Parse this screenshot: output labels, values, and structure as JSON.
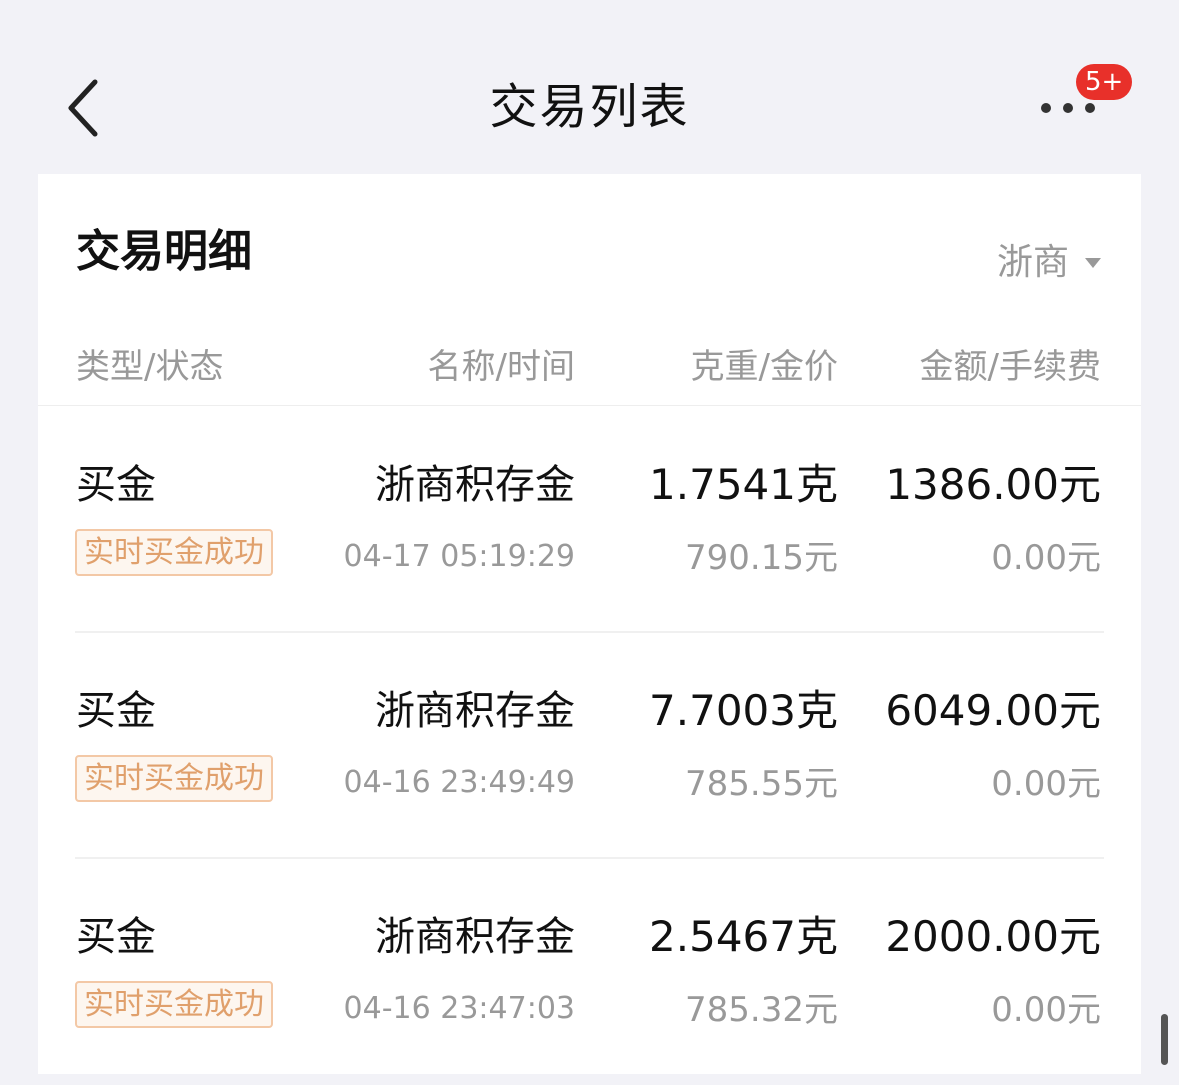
{
  "navbar": {
    "title": "交易列表",
    "badge": "5+"
  },
  "card": {
    "title": "交易明细",
    "filter_label": "浙商"
  },
  "columns": {
    "type_status": "类型/状态",
    "name_time": "名称/时间",
    "weight_price": "克重/金价",
    "amount_fee": "金额/手续费"
  },
  "transactions": [
    {
      "type": "买金",
      "status": "实时买金成功",
      "name": "浙商积存金",
      "time": "04-17 05:19:29",
      "weight": "1.7541克",
      "price": "790.15元",
      "amount": "1386.00元",
      "fee": "0.00元"
    },
    {
      "type": "买金",
      "status": "实时买金成功",
      "name": "浙商积存金",
      "time": "04-16 23:49:49",
      "weight": "7.7003克",
      "price": "785.55元",
      "amount": "6049.00元",
      "fee": "0.00元"
    },
    {
      "type": "买金",
      "status": "实时买金成功",
      "name": "浙商积存金",
      "time": "04-16 23:47:03",
      "weight": "2.5467克",
      "price": "785.32元",
      "amount": "2000.00元",
      "fee": "0.00元"
    }
  ],
  "colors": {
    "page_bg": "#f2f2f7",
    "badge": "#e8302a",
    "status_text": "#e0a06c",
    "status_border": "#f3c8a6",
    "muted_text": "#999999"
  },
  "icons": {
    "back": "chevron-left-icon",
    "more": "more-dots-icon",
    "filter": "caret-down-icon"
  }
}
